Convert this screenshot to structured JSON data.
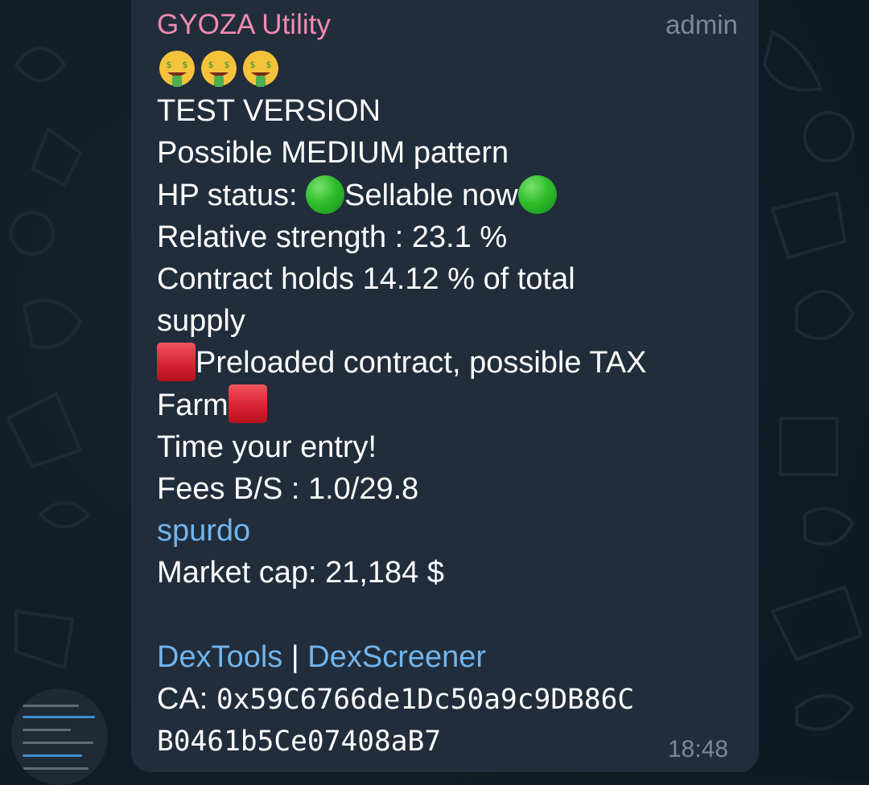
{
  "chat": {
    "sender_name": "GYOZA Utility",
    "sender_role": "admin",
    "time": "18:48",
    "colors": {
      "bubble": "#212d3b",
      "sender": "#f18bb2",
      "link": "#71b5ef",
      "meta": "#7b8995",
      "text": "#ffffff"
    }
  },
  "message": {
    "emoji_row": [
      "money-mouth-face",
      "money-mouth-face",
      "money-mouth-face"
    ],
    "title": "TEST VERSION",
    "pattern": "Possible MEDIUM pattern",
    "hp_label": "HP status: ",
    "hp_value": "Sellable now",
    "hp_icon": "green-circle",
    "strength": "Relative strength : 23.1  %",
    "contract_line1": "Contract holds 14.12 % of total",
    "contract_line2": "supply",
    "preload_line1": "Preloaded contract, possible TAX",
    "preload_line2": "Farm",
    "preload_icon": "red-square",
    "entry": "Time your entry!",
    "fees": "Fees B/S : 1.0/29.8",
    "token_link": "spurdo",
    "market_cap": "Market cap: 21,184 $",
    "dextools_link": "DexTools",
    "separator": " | ",
    "dexscreener_link": "DexScreener",
    "ca_label": "CA: ",
    "ca_line1": "0x59C6766de1Dc50a9c9DB86C",
    "ca_line2": "B0461b5Ce07408aB7"
  }
}
